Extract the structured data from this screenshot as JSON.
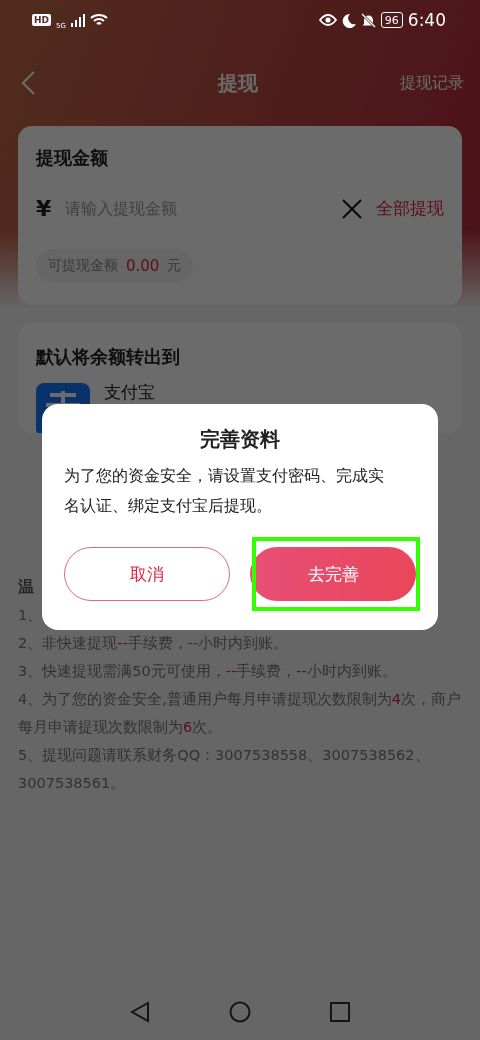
{
  "status_bar": {
    "hd_badge": "HD",
    "network": "5G",
    "battery": "96",
    "time": "6:40"
  },
  "header": {
    "title": "提现",
    "action": "提现记录"
  },
  "amount_card": {
    "title": "提现金额",
    "currency": "¥",
    "placeholder": "请输入提现金额",
    "withdraw_all": "全部提现",
    "available_label": "可提现金额",
    "available_value": "0.00",
    "available_unit": "元"
  },
  "account_card": {
    "title": "默认将余额转出到",
    "account": "支付宝"
  },
  "tips": {
    "title": "温",
    "lines": [
      {
        "segments": [
          {
            "text": "1、",
            "kind": "text"
          }
        ]
      },
      {
        "segments": [
          {
            "text": "2、非快速提现",
            "kind": "text"
          },
          {
            "text": "--",
            "kind": "emphasis"
          },
          {
            "text": "手续费，--小时内到账。",
            "kind": "text"
          }
        ]
      },
      {
        "segments": [
          {
            "text": "3、快速提现需满50元可使用，",
            "kind": "text"
          },
          {
            "text": "--",
            "kind": "emphasis"
          },
          {
            "text": "手续费，",
            "kind": "text"
          },
          {
            "text": "--",
            "kind": "emphasis"
          },
          {
            "text": "小时内到账。",
            "kind": "text"
          }
        ]
      },
      {
        "segments": [
          {
            "text": "4、为了您的资金安全,普通用户每月申请提现次数限制为",
            "kind": "text"
          },
          {
            "text": "4",
            "kind": "emphasis"
          },
          {
            "text": "次，商户每月申请提现次数限制为",
            "kind": "text"
          },
          {
            "text": "6",
            "kind": "emphasis"
          },
          {
            "text": "次。",
            "kind": "text"
          }
        ]
      },
      {
        "segments": [
          {
            "text": "5、提现问题请联系财务QQ：3007538558、3007538562、3007538561。",
            "kind": "text"
          }
        ]
      }
    ]
  },
  "dialog": {
    "title": "完善资料",
    "message": "为了您的资金安全，请设置支付密码、完成实名认证、绑定支付宝后提现。",
    "buttons": [
      {
        "label": "取消",
        "kind": "outline",
        "highlighted": false
      },
      {
        "label": "去完善",
        "kind": "filled",
        "highlighted": true
      }
    ]
  }
}
